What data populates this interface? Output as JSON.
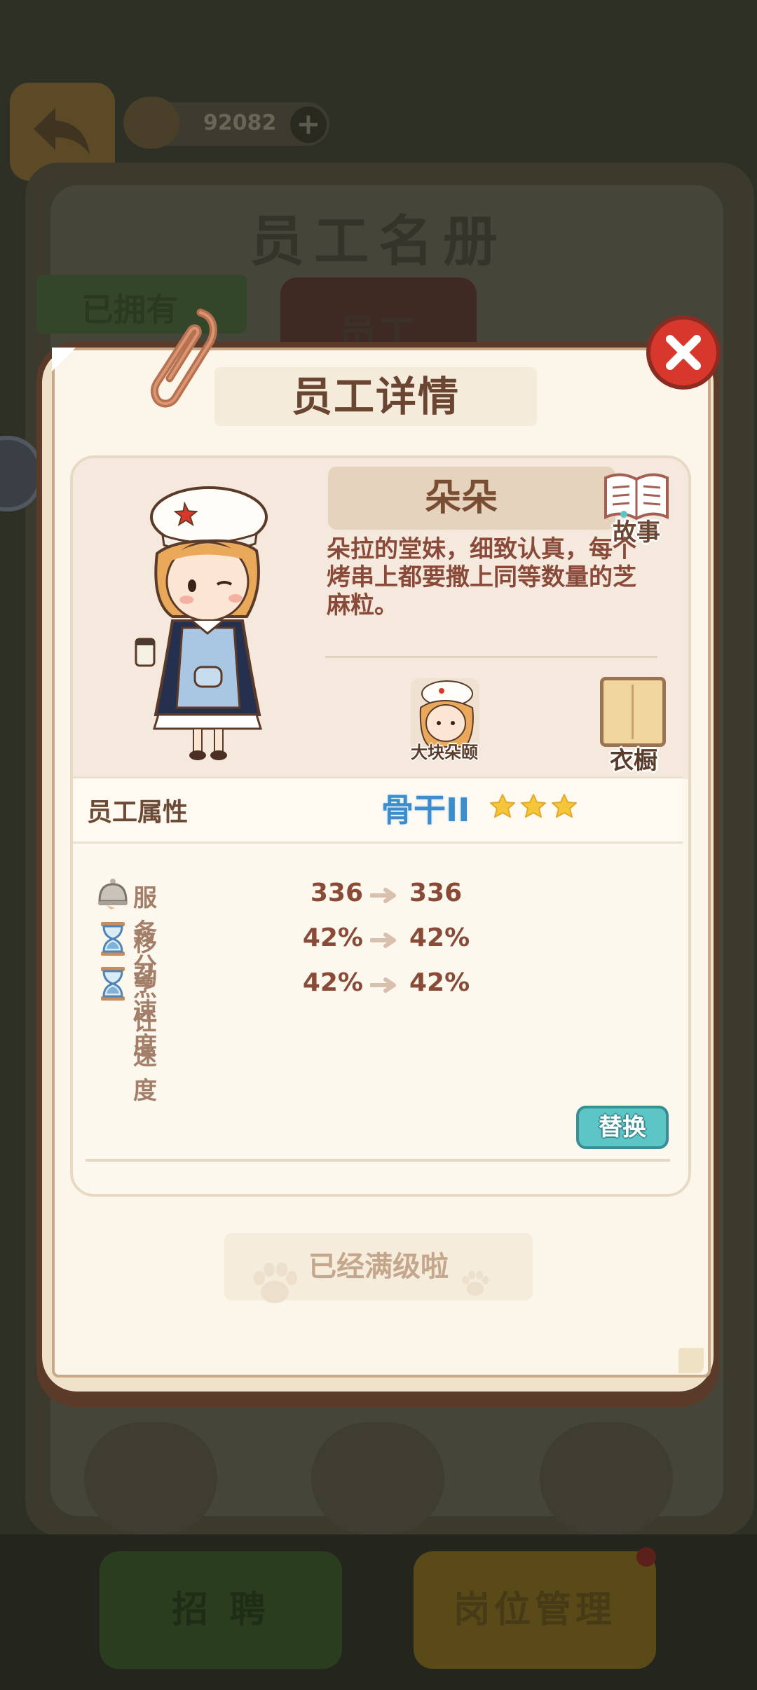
{
  "background": {
    "currency_value": "92082",
    "roster_title": "员工名册",
    "owned_tab": "已拥有",
    "staff_tab": "员工",
    "recruit_button": "招 聘",
    "jobs_button": "岗位管理"
  },
  "modal": {
    "title": "员工详情",
    "employee": {
      "name": "朵朵",
      "description": "朵拉的堂妹，细致认真，每个烤串上都要撒上同等数量的芝麻粒。",
      "story_label": "故事",
      "skin_label": "大块朵颐",
      "wardrobe_label": "衣橱"
    },
    "attributes": {
      "label": "员工属性",
      "rank": "骨干II",
      "star_count": 3,
      "stats": [
        {
          "icon": "service-bell-icon",
          "name": "服务分",
          "from": "336",
          "to": "336"
        },
        {
          "icon": "hourglass-icon",
          "name": "移动速度",
          "from": "42%",
          "to": "42%"
        },
        {
          "icon": "hourglass-icon",
          "name": "烹饪速度",
          "from": "42%",
          "to": "42%"
        }
      ]
    },
    "replace_button": "替换",
    "max_level_text": "已经满级啦"
  },
  "colors": {
    "accent_teal": "#5cc5c6",
    "close_red": "#d8382c",
    "title_brown": "#6a4532",
    "rank_blue": "#3d8ccc",
    "star_yellow": "#f5c63a"
  }
}
